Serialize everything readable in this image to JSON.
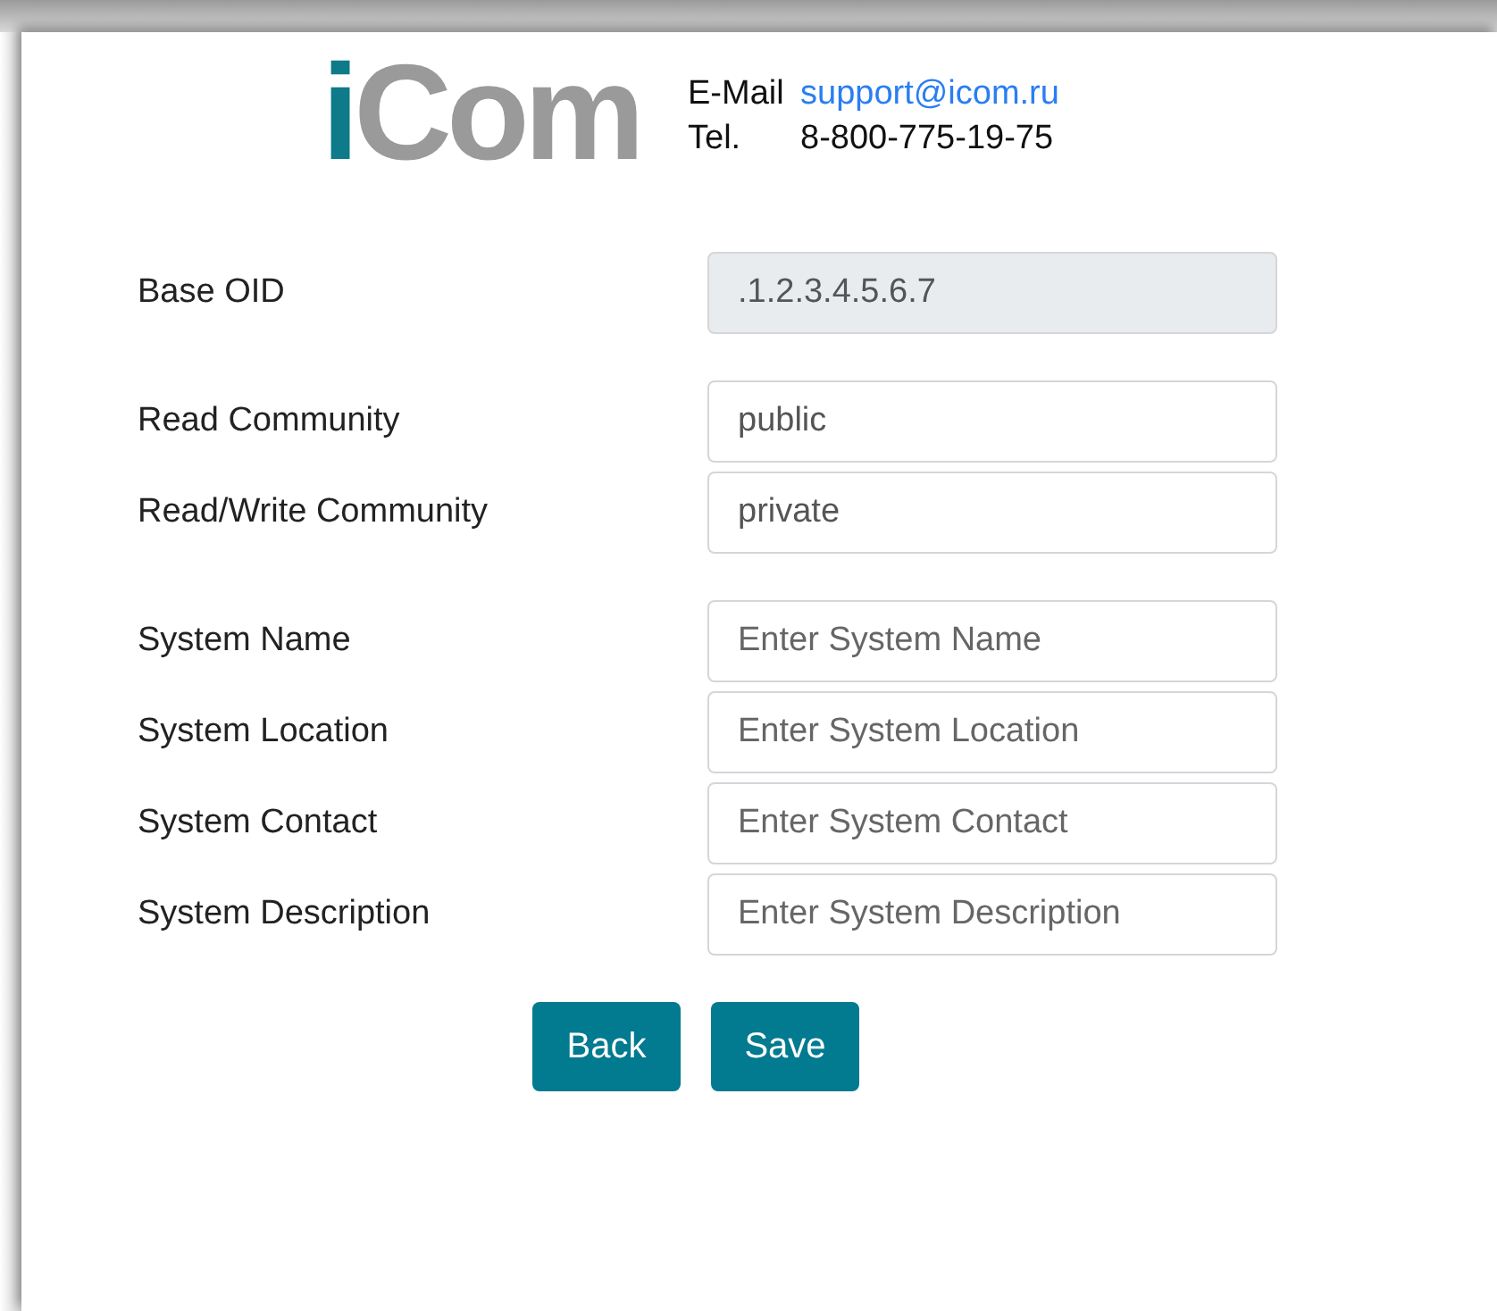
{
  "logo": {
    "parts": [
      {
        "text": "i",
        "color": "#0e7a8a"
      },
      {
        "text": "Com",
        "color": "#9a9a9a"
      }
    ]
  },
  "contact": {
    "email_label": "E-Mail",
    "email": "support@icom.ru",
    "phone_label": "Tel.",
    "phone": "8-800-775-19-75"
  },
  "groups": [
    [
      {
        "label": "Base OID",
        "value": ".1.2.3.4.5.6.7",
        "disabled": true
      }
    ],
    [
      {
        "label": "Read Community",
        "value": "public",
        "disabled": false
      },
      {
        "label": "Read/Write Community",
        "value": "private",
        "disabled": false
      }
    ],
    [
      {
        "label": "System Name",
        "placeholder": "Enter System Name",
        "disabled": false
      },
      {
        "label": "System Location",
        "placeholder": "Enter System Location",
        "disabled": false
      },
      {
        "label": "System Contact",
        "placeholder": "Enter System Contact",
        "disabled": false
      },
      {
        "label": "System Description",
        "placeholder": "Enter System Description",
        "disabled": false
      }
    ]
  ],
  "buttons": [
    "Back",
    "Save"
  ]
}
